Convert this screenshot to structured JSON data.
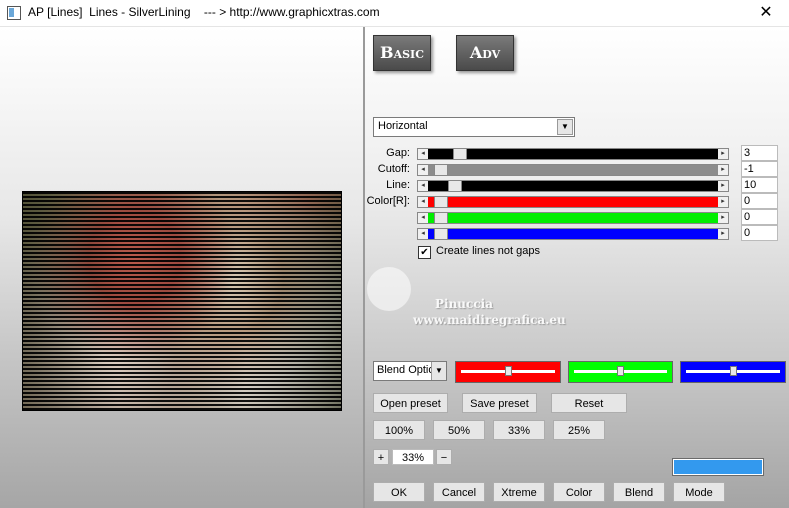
{
  "window": {
    "title": "AP [Lines]  Lines - SilverLining    --- > http://www.graphicxtras.com",
    "close_label": "✕"
  },
  "mode_buttons": {
    "basic": "Basic",
    "adv": "Adv"
  },
  "direction": {
    "selected": "Horizontal"
  },
  "sliders": [
    {
      "label": "Gap:",
      "value": "3",
      "color": "#000000",
      "level": 0.07
    },
    {
      "label": "Cutoff:",
      "value": "-1",
      "color": "#8c8c8c",
      "level": 0.0
    },
    {
      "label": "Line:",
      "value": "10",
      "color": "#000000",
      "level": 0.05
    },
    {
      "label": "Color[R]:",
      "value": "0",
      "color": "#ff0000",
      "level": 0.0
    },
    {
      "label": "",
      "value": "0",
      "color": "#00ee00",
      "level": 0.0
    },
    {
      "label": "",
      "value": "0",
      "color": "#0000ff",
      "level": 0.0
    }
  ],
  "checkbox": {
    "checked_glyph": "✔",
    "label": "Create lines not gaps"
  },
  "blend": {
    "select_text": "Blend Options",
    "color_sliders": [
      {
        "color": "#ff0000",
        "level": 0.5
      },
      {
        "color": "#00ff00",
        "level": 0.5
      },
      {
        "color": "#0000ff",
        "level": 0.5
      }
    ]
  },
  "preset_buttons": {
    "open": "Open preset",
    "save": "Save preset",
    "reset": "Reset"
  },
  "zoom_buttons": [
    "100%",
    "50%",
    "33%",
    "25%"
  ],
  "zoom": {
    "plus": "+",
    "value": "33%",
    "minus": "−"
  },
  "bottom_buttons": [
    "OK",
    "Cancel",
    "Xtreme",
    "Color",
    "Blend",
    "Mode"
  ],
  "watermark": {
    "name": "Pinuccia",
    "url": "www.maidiregrafica.eu"
  },
  "colors": {
    "accent": "#3399ee"
  }
}
